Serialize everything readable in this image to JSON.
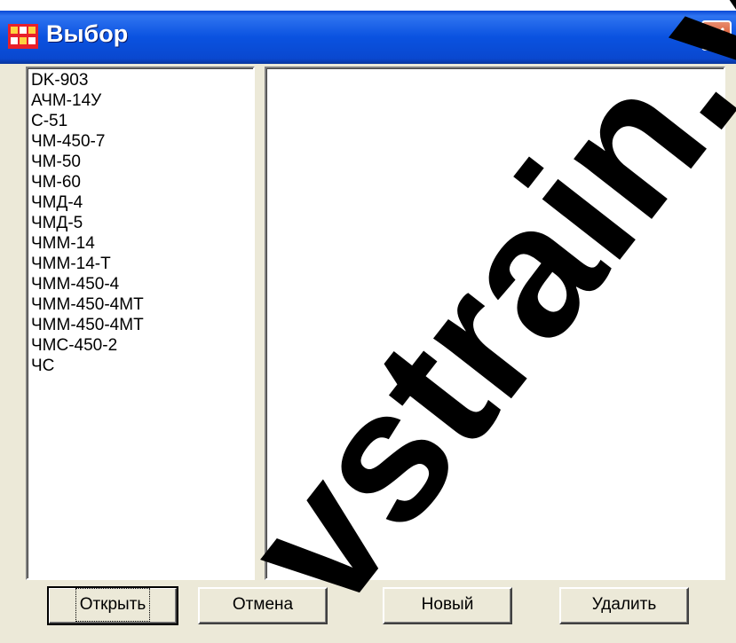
{
  "window": {
    "title": "Выбор"
  },
  "left_list": {
    "items": [
      "DK-903",
      "АЧМ-14У",
      "С-51",
      "ЧМ-450-7",
      "ЧМ-50",
      "ЧМ-60",
      "ЧМД-4",
      "ЧМД-5",
      "ЧММ-14",
      "ЧММ-14-Т",
      "ЧММ-450-4",
      "ЧММ-450-4МТ",
      "ЧММ-450-4МТ",
      "ЧМС-450-2",
      "ЧС"
    ]
  },
  "buttons": {
    "open": "Открыть",
    "cancel": "Отмена",
    "new": "Новый",
    "delete": "Удалить"
  },
  "icons": {
    "app": "app-icon",
    "close": "close-icon"
  },
  "colors": {
    "titlebar": "#0a52e0",
    "window_bg": "#ece9d8",
    "close": "#d95a32"
  },
  "watermark": {
    "text": "vstrain.vst"
  }
}
